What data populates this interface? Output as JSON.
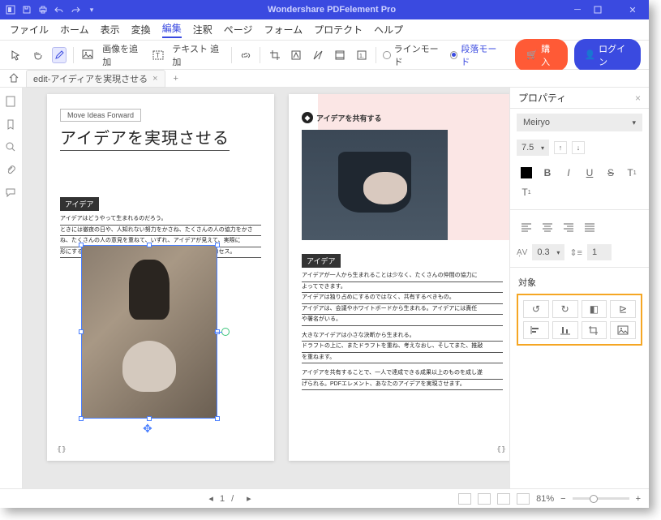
{
  "titlebar": {
    "title": "Wondershare PDFelement Pro"
  },
  "menu": {
    "items": [
      "ファイル",
      "ホーム",
      "表示",
      "変換",
      "編集",
      "注釈",
      "ページ",
      "フォーム",
      "プロテクト",
      "ヘルプ"
    ],
    "active": 4
  },
  "toolbar": {
    "add_image": "画像を追加",
    "add_text": "テキスト 追加",
    "line_mode": "ラインモード",
    "para_mode": "段落モード",
    "buy": "購入",
    "login": "ログイン"
  },
  "tabs": {
    "doc": "edit-アイディアを実現させる"
  },
  "props": {
    "title": "プロパティ",
    "font": "Meiryo",
    "size": "7.5",
    "char_spacing": "0.3",
    "line_spacing": "1",
    "object": "対象"
  },
  "page1": {
    "moveideas": "Move Ideas Forward",
    "headline": "アイデアを実現させる",
    "sub": "アイデア",
    "b1": "アイデアはどうやって生まれるのだろう。",
    "b2": "ときには徹夜の日や、人知れない努力をかさね、たくさんの人の協力をかさ",
    "b3": "ね、たくさんの人の意見を重ねて、いずれ、アイデアが見えて、実際に",
    "b4": "形にすることができる。アイデアとは、何かを実現させるプロセス。"
  },
  "page2": {
    "share": "アイデアを共有する",
    "sub": "アイデア",
    "b1": "アイデアが一人から生まれることは少なく、たくさんの仲間の協力に",
    "b2": "よってできます。",
    "b3": "アイデアは独り占めにするのではなく、共有するべきもの。",
    "b4": "アイデアは、会議やホワイトボードから生まれる。アイデアには責任",
    "b5": "や署名がいる。",
    "b6": "大きなアイデアは小さな決断から生まれる。",
    "b7": "ドラフトの上に、またドラフトを重ね、考えなおし、そしてまた、推敲",
    "b8": "を重ねます。",
    "b9": "アイデアを共有することで、一人で達成できる成果以上のものを成し遂",
    "b10": "げられる。PDFエレメント、あなたのアイデアを実現させます。"
  },
  "status": {
    "page_cur": "1",
    "page_sep": "/",
    "page_tot": "",
    "zoom": "81%"
  }
}
